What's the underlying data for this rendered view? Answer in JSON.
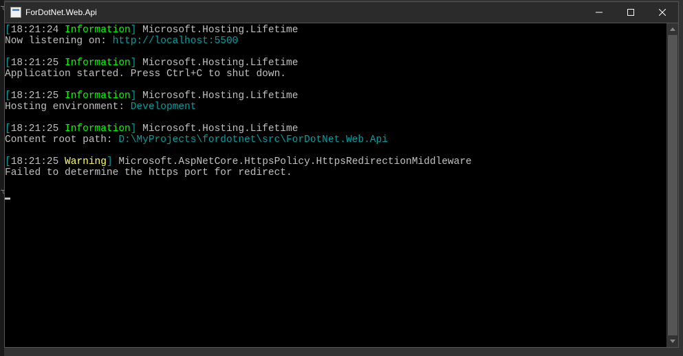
{
  "window": {
    "title": "ForDotNet.Web.Api"
  },
  "log_entries": [
    {
      "time": "18:21:24",
      "level": "Information",
      "logger": "Microsoft.Hosting.Lifetime",
      "message_parts": [
        {
          "t": "msg",
          "v": "Now listening on: "
        },
        {
          "t": "link",
          "v": "http://localhost:5500"
        }
      ]
    },
    {
      "time": "18:21:25",
      "level": "Information",
      "logger": "Microsoft.Hosting.Lifetime",
      "message_parts": [
        {
          "t": "msg",
          "v": "Application started. Press Ctrl+C to shut down."
        }
      ]
    },
    {
      "time": "18:21:25",
      "level": "Information",
      "logger": "Microsoft.Hosting.Lifetime",
      "message_parts": [
        {
          "t": "msg",
          "v": "Hosting environment: "
        },
        {
          "t": "link",
          "v": "Development"
        }
      ]
    },
    {
      "time": "18:21:25",
      "level": "Information",
      "logger": "Microsoft.Hosting.Lifetime",
      "message_parts": [
        {
          "t": "msg",
          "v": "Content root path: "
        },
        {
          "t": "link",
          "v": "D:\\MyProjects\\fordotnet\\src\\ForDotNet.Web.Api"
        }
      ]
    },
    {
      "time": "18:21:25",
      "level": "Warning",
      "logger": "Microsoft.AspNetCore.HttpsPolicy.HttpsRedirectionMiddleware",
      "message_parts": [
        {
          "t": "msg",
          "v": "Failed to determine the https port for redirect."
        }
      ]
    }
  ]
}
